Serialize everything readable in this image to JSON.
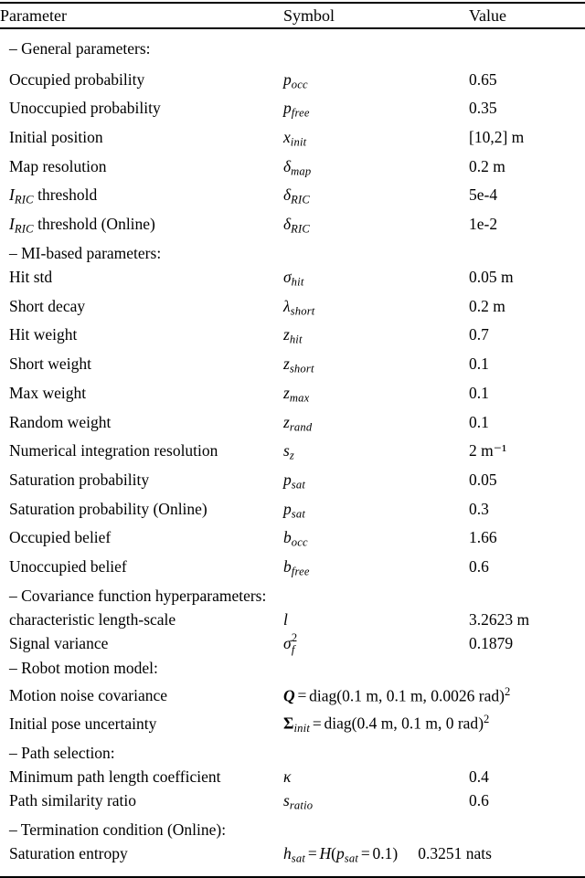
{
  "table": {
    "columns": [
      "Parameter",
      "Symbol",
      "Value"
    ],
    "rows": [
      {
        "type": "section",
        "parameter": "– General parameters:",
        "symbol": "",
        "value": ""
      },
      {
        "type": "data",
        "parameter": "Occupied probability",
        "symbol": "p_occ",
        "value": "0.65"
      },
      {
        "type": "data",
        "parameter": "Unoccupied probability",
        "symbol": "p_free",
        "value": "0.35"
      },
      {
        "type": "data",
        "parameter": "Initial position",
        "symbol": "x_init",
        "value": "[10,2] m"
      },
      {
        "type": "data",
        "parameter": "Map resolution",
        "symbol": "δ_map",
        "value": "0.2 m"
      },
      {
        "type": "data",
        "parameter": "I_RIC threshold",
        "symbol": "δ_RIC",
        "value": "5e-4"
      },
      {
        "type": "data",
        "parameter": "I_RIC threshold (Online)",
        "symbol": "δ_RIC",
        "value": "1e-2"
      },
      {
        "type": "section",
        "parameter": "– MI-based parameters:",
        "symbol": "",
        "value": ""
      },
      {
        "type": "data",
        "parameter": "Hit std",
        "symbol": "σ_hit",
        "value": "0.05 m"
      },
      {
        "type": "data",
        "parameter": "Short decay",
        "symbol": "λ_short",
        "value": "0.2 m"
      },
      {
        "type": "data",
        "parameter": "Hit weight",
        "symbol": "z_hit",
        "value": "0.7"
      },
      {
        "type": "data",
        "parameter": "Short weight",
        "symbol": "z_short",
        "value": "0.1"
      },
      {
        "type": "data",
        "parameter": "Max weight",
        "symbol": "z_max",
        "value": "0.1"
      },
      {
        "type": "data",
        "parameter": "Random weight",
        "symbol": "z_rand",
        "value": "0.1"
      },
      {
        "type": "data",
        "parameter": "Numerical integration resolution",
        "symbol": "s_z",
        "value": "2 m⁻¹"
      },
      {
        "type": "data",
        "parameter": "Saturation probability",
        "symbol": "p_sat",
        "value": "0.05"
      },
      {
        "type": "data",
        "parameter": "Saturation probability (Online)",
        "symbol": "p_sat",
        "value": "0.3"
      },
      {
        "type": "data",
        "parameter": "Occupied belief",
        "symbol": "b_occ",
        "value": "1.66"
      },
      {
        "type": "data",
        "parameter": "Unoccupied belief",
        "symbol": "b_free",
        "value": "0.6"
      },
      {
        "type": "section",
        "parameter": "– Covariance function hyperparameters:",
        "symbol": "",
        "value": ""
      },
      {
        "type": "data",
        "parameter": "characteristic length-scale",
        "symbol": "l",
        "value": "3.2623 m"
      },
      {
        "type": "data",
        "parameter": "Signal variance",
        "symbol": "σ_f^2",
        "value": "0.1879"
      },
      {
        "type": "section",
        "parameter": "– Robot motion model:",
        "symbol": "",
        "value": ""
      },
      {
        "type": "data",
        "parameter": "Motion noise covariance",
        "symbol": "Q = diag(0.1 m, 0.1 m, 0.0026 rad)²",
        "value": ""
      },
      {
        "type": "data",
        "parameter": "Initial pose uncertainty",
        "symbol": "Σ_init = diag(0.4 m, 0.1 m, 0 rad)²",
        "value": ""
      },
      {
        "type": "section",
        "parameter": "– Path selection:",
        "symbol": "",
        "value": ""
      },
      {
        "type": "data",
        "parameter": "Minimum path length coefficient",
        "symbol": "κ",
        "value": "0.4"
      },
      {
        "type": "data",
        "parameter": "Path similarity ratio",
        "symbol": "s_ratio",
        "value": "0.6"
      },
      {
        "type": "section",
        "parameter": "– Termination condition (Online):",
        "symbol": "",
        "value": ""
      },
      {
        "type": "data",
        "parameter": "Saturation entropy",
        "symbol": "h_sat = H(p_sat = 0.1)",
        "value": "0.3251 nats"
      }
    ]
  },
  "symbols": {
    "p_occ": {
      "base": "p",
      "sub": "occ"
    },
    "p_free": {
      "base": "p",
      "sub": "free"
    },
    "x_init": {
      "base": "x",
      "sub": "init"
    },
    "delta_map": {
      "base": "δ",
      "sub": "map"
    },
    "delta_RIC": {
      "base": "δ",
      "sub": "RIC"
    },
    "sigma_hit": {
      "base": "σ",
      "sub": "hit"
    },
    "lambda_short": {
      "base": "λ",
      "sub": "short"
    },
    "z_hit": {
      "base": "z",
      "sub": "hit"
    },
    "z_short": {
      "base": "z",
      "sub": "short"
    },
    "z_max": {
      "base": "z",
      "sub": "max"
    },
    "z_rand": {
      "base": "z",
      "sub": "rand"
    },
    "s_z": {
      "base": "s",
      "sub": "z"
    },
    "p_sat": {
      "base": "p",
      "sub": "sat"
    },
    "b_occ": {
      "base": "b",
      "sub": "occ"
    },
    "b_free": {
      "base": "b",
      "sub": "free"
    },
    "l": {
      "base": "l",
      "sub": ""
    },
    "sigma_f2": {
      "base": "σ",
      "sup": "2",
      "sub": "f"
    },
    "kappa": {
      "base": "κ",
      "sub": ""
    },
    "s_ratio": {
      "base": "s",
      "sub": "ratio"
    },
    "h_sat": {
      "base": "h",
      "sub": "sat"
    },
    "Q": {
      "base": "Q",
      "sub": ""
    },
    "Sigma_init": {
      "base": "Σ",
      "sub": "init"
    },
    "H": {
      "base": "H",
      "sub": ""
    }
  },
  "equations": {
    "motion_noise": {
      "lhs": "Q",
      "eq": "=",
      "fn": "diag",
      "args": "0.1 m, 0.1 m, 0.0026 rad",
      "power": "2"
    },
    "initial_pose": {
      "lhs_base": "Σ",
      "lhs_sub": "init",
      "eq": "=",
      "fn": "diag",
      "args": "0.4 m, 0.1 m, 0 rad",
      "power": "2"
    },
    "saturation_entropy": {
      "lhs_base": "h",
      "lhs_sub": "sat",
      "eq": "=",
      "fn": "H",
      "arg_base": "p",
      "arg_sub": "sat",
      "arg_eq": "=",
      "arg_val": "0.1"
    }
  },
  "labels": {
    "iric_base": "I",
    "iric_sub": "RIC",
    "iric_threshold_suffix": " threshold",
    "iric_threshold_online_suffix": " threshold (Online)"
  }
}
